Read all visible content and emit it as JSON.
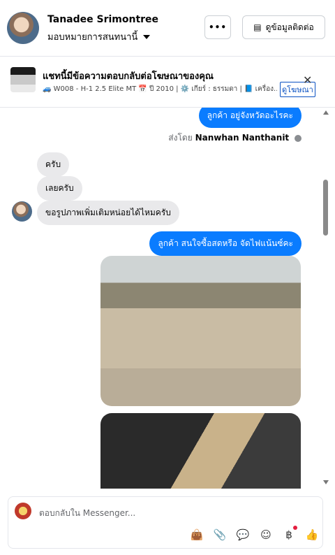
{
  "header": {
    "name": "Tanadee Srimontree",
    "subtitle": "มอบหมายการสนทนานี้",
    "more_label": "•••",
    "contact_label": "ดูข้อมูลติดต่อ",
    "contact_icon": "▤"
  },
  "ad": {
    "title": "แชทนี้มีข้อความตอบกลับต่อโฆษณาของคุณ",
    "details": "🚙 W008 - H-1 2.5 Elite MT 📅 ปี 2010 | ⚙️ เกียร์ : ธรรมดา | 📘 เครื่อง...",
    "link_label": "ดูโฆษณา",
    "close_label": "✕"
  },
  "messages": {
    "m1": "ลูกค้า อยู่จังหวัดอะไรคะ",
    "sent_prefix": "ส่งโดย",
    "sent_by": "Nanwhan Nanthanit",
    "m2": "ครับ",
    "m3": "เลยครับ",
    "m4": "ขอรูปภาพเพิ่มเติมหน่อยได้ไหมครับ",
    "m5": "ลูกค้า สนใจซื้อสดหรือ จัดไฟแน้นซ์คะ"
  },
  "composer": {
    "placeholder": "ตอบกลับใน Messenger...",
    "icons": [
      "👜",
      "📎",
      "💬",
      "☺",
      "฿",
      "👍"
    ]
  },
  "colors": {
    "accent": "#0a7cff",
    "incoming": "#e9e9eb",
    "notification": "#e41e3f"
  }
}
